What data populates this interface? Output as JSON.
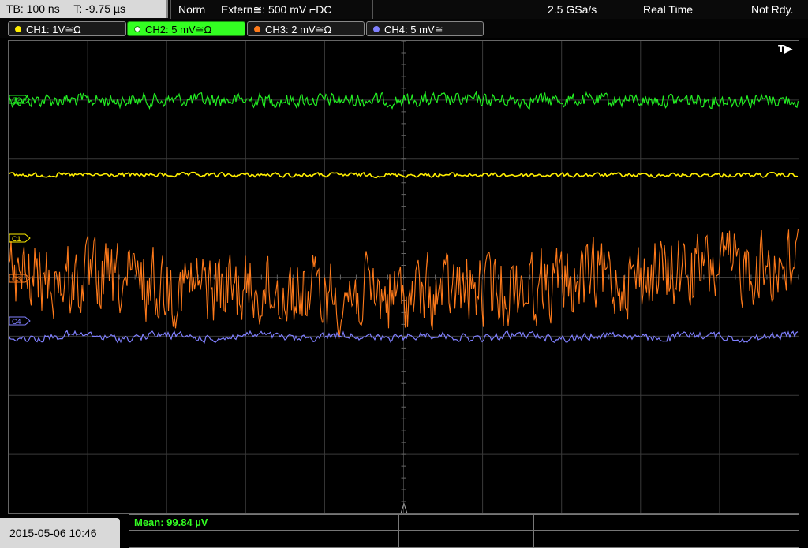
{
  "top_bar": {
    "timebase": "TB: 100 ns",
    "trigger_time": "T: -9.75 µs",
    "mode": "Norm",
    "trigger": "Extern≅: 500 mV ⌐DC",
    "sample_rate": "2.5 GSa/s",
    "acquisition": "Real Time",
    "status": "Not Rdy."
  },
  "channels": [
    {
      "label": "CH1: 1V≅Ω",
      "color": "#ffee00",
      "active": false
    },
    {
      "label": "CH2: 5 mV≅Ω",
      "color": "#33ff22",
      "active": true
    },
    {
      "label": "CH3: 2 mV≅Ω",
      "color": "#ff7a1a",
      "active": false
    },
    {
      "label": "CH4: 5 mV≅",
      "color": "#8080ff",
      "active": false
    }
  ],
  "markers": {
    "c1": "C1",
    "c3": "C3",
    "c4": "C4",
    "c2": "C2",
    "trigger": "T▶"
  },
  "bottom": {
    "datetime": "2015-05-06 10:46",
    "measurement": "Mean: 99.84 µV"
  }
}
